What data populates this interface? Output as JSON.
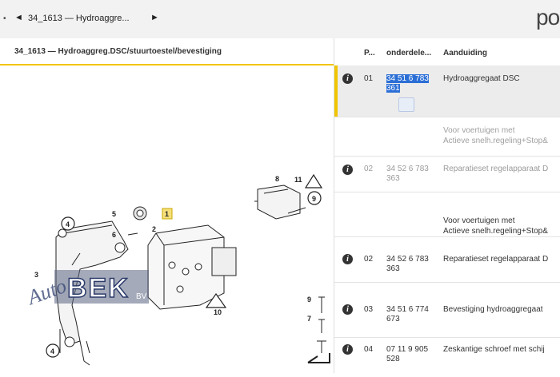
{
  "topbar": {
    "left_dot": "•",
    "nav_back": "◄",
    "breadcrumb": "34_1613 — Hydroaggre...",
    "nav_forward": "►",
    "logo_text": "po"
  },
  "left_panel": {
    "title": "34_1613 — Hydroaggreg.DSC/stuurtoestel/bevestiging"
  },
  "diagram": {
    "callouts": [
      "1",
      "2",
      "3",
      "4",
      "4",
      "5",
      "6",
      "7",
      "8",
      "9",
      "9",
      "10",
      "11"
    ],
    "watermark": {
      "script": "Auto",
      "main": "BEK",
      "suffix": "BV"
    }
  },
  "table": {
    "headers": {
      "info": "",
      "pos": "P...",
      "part": "onderdele...",
      "desc": "Aanduiding"
    },
    "rows": [
      {
        "pos": "01",
        "part": "34 51 6 783 361",
        "part_line1": "34 51 6 783",
        "part_line2": "361",
        "desc": "Hydroaggregaat DSC",
        "selected": true
      },
      {
        "note_line1": "Voor voertuigen met",
        "note_line2": "Actieve snelh.regeling+Stop&",
        "muted": true
      },
      {
        "pos": "02",
        "part_line1": "34 52 6 783",
        "part_line2": "363",
        "desc": "Reparatieset regelapparaat D",
        "muted": true
      },
      {
        "note_line1": "Voor voertuigen met",
        "note_line2": "Actieve snelh.regeling+Stop&"
      },
      {
        "pos": "02",
        "part_line1": "34 52 6 783",
        "part_line2": "363",
        "desc": "Reparatieset regelapparaat D"
      },
      {
        "pos": "03",
        "part_line1": "34 51 6 774",
        "part_line2": "673",
        "desc": "Bevestiging hydroaggregaat"
      },
      {
        "pos": "04",
        "part_line1": "07 11 9 905",
        "part_line2": "528",
        "desc": "Zeskantige schroef met schij"
      }
    ]
  },
  "colors": {
    "accent": "#f0c400",
    "selection": "#2b6fd6"
  }
}
